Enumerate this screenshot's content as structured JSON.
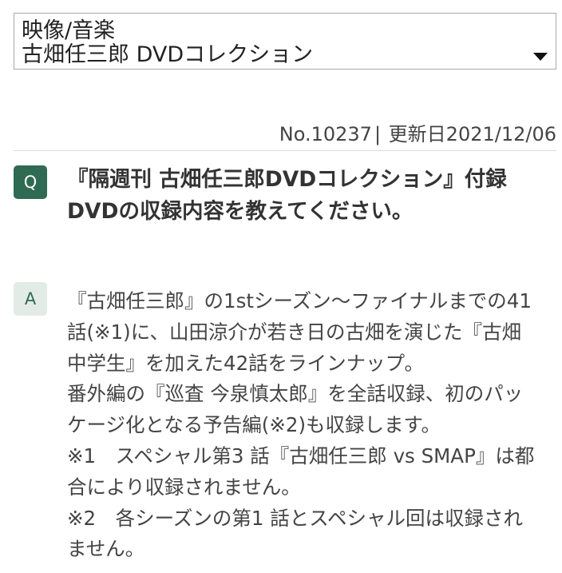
{
  "category": {
    "line1": "映像/音楽",
    "line2": "古畑任三郎 DVDコレクション"
  },
  "meta": {
    "number": "No.10237",
    "separator": "|",
    "updated": "更新日2021/12/06"
  },
  "question": {
    "badge": "Q",
    "lines": [
      "『隔週刊 古畑任三郎DVDコレクション』付録",
      "DVDの収録内容を教えてください。"
    ]
  },
  "answer": {
    "badge": "A",
    "lines": [
      "『古畑任三郎』の1stシーズン〜ファイナルまでの41",
      "話(※1)に、山田涼介が若き日の古畑を演じた『古畑",
      "中学生』を加えた42話をラインナップ。",
      "番外編の『巡査 今泉慎太郎』を全話収録、初のパッ",
      "ケージ化となる予告編(※2)も収録します。",
      "※1　スペシャル第3 話『古畑任三郎 vs SMAP』は都",
      "合により収録されません。",
      "※2　各シーズンの第1 話とスペシャル回は収録され",
      "ません。"
    ]
  }
}
